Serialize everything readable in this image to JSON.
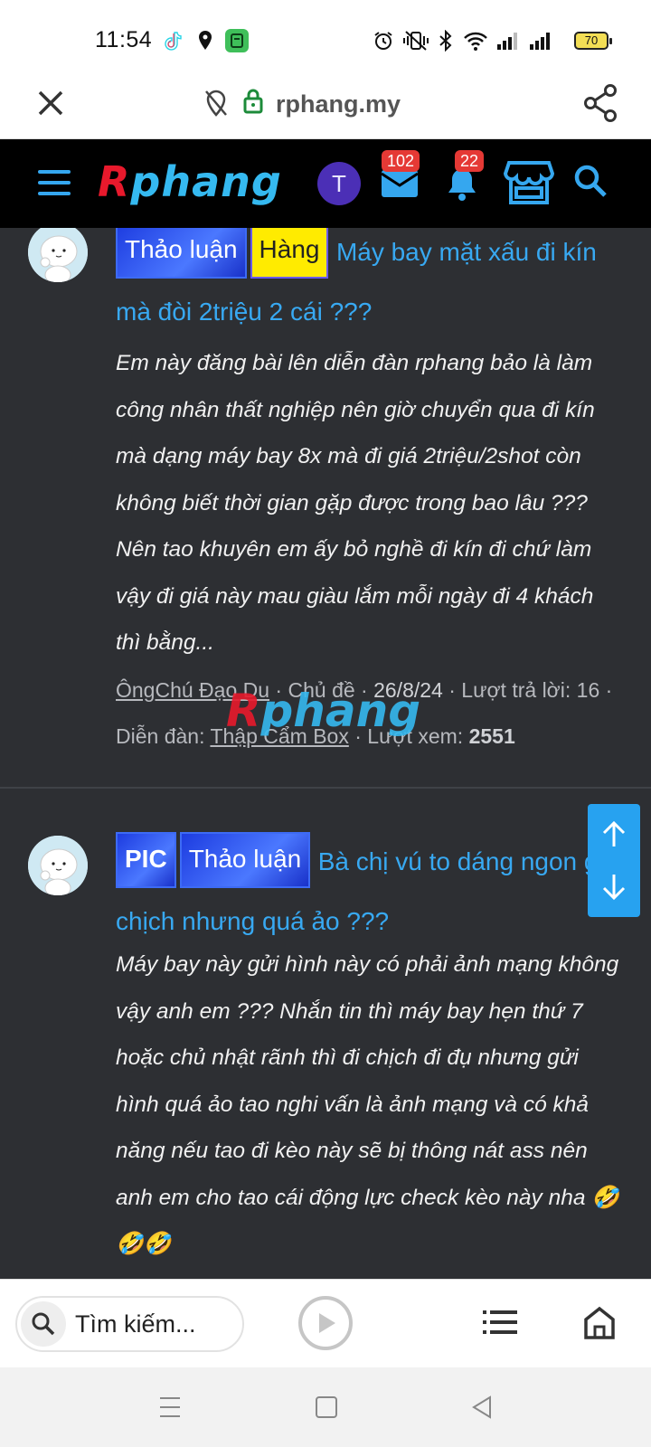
{
  "status_bar": {
    "time": "11:54",
    "battery": "70",
    "icons": [
      "tiktok-icon",
      "location-icon",
      "app-icon",
      "alarm-icon",
      "vibrate-off-icon",
      "bluetooth-icon",
      "wifi-icon",
      "signal-icon",
      "signal-icon"
    ]
  },
  "browser": {
    "domain": "rphang.my",
    "close_icon": "close-icon",
    "share_icon": "share-icon"
  },
  "site_header": {
    "logo_first": "R",
    "logo_rest": "phang",
    "avatar_letter": "T",
    "messages_count": "102",
    "alerts_count": "22",
    "colors": {
      "logo_red": "#e8192c",
      "logo_blue": "#35b9f0",
      "link": "#38a9f2",
      "avatar": "#4b2fb6"
    }
  },
  "threads": [
    {
      "tags": [
        "Thảo luận",
        "Hàng"
      ],
      "title": "Máy bay mặt xấu đi kín mà đòi 2triệu 2 cái ???",
      "snippet": "Em này đăng bài lên diễn đàn rphang bảo là làm công nhân thất nghiệp nên giờ chuyển qua đi kín mà dạng máy bay 8x mà đi giá 2triệu/2shot còn không biết thời gian gặp được trong bao lâu ??? Nên tao khuyên em ấy bỏ nghề đi kín đi chứ làm vậy đi giá này mau giàu lắm mỗi ngày đi 4 khách thì bằng...",
      "author": "ÔngChú Đạo Du",
      "sep1": " · Chủ đề · ",
      "date": "26/8/24",
      "replies_label": " · Lượt trả lời: ",
      "replies": "16",
      "forum_label": " · Diễn đàn: ",
      "forum": "Thập Cẩm Box",
      "views_label": " · Lượt xem: ",
      "views": "2551"
    },
    {
      "tags": [
        "PIC",
        "Thảo luận"
      ],
      "title": "Bà chị vú to dáng ngon gạ chịch nhưng quá ảo ???",
      "snippet": "Máy bay này gửi hình này có phải ảnh mạng không vậy anh em ??? Nhắn tin thì máy bay hẹn thứ 7 hoặc chủ nhật rãnh thì đi chịch đi đụ nhưng gửi hình quá ảo tao nghi vấn là ảnh mạng và có khả năng nếu tao đi kèo này sẽ bị thông nát ass nên anh em cho tao cái động lực check kèo này nha 🤣🤣🤣"
    }
  ],
  "watermark": {
    "first": "R",
    "rest": "phang"
  },
  "bottom_bar": {
    "search_placeholder": "Tìm kiếm..."
  }
}
